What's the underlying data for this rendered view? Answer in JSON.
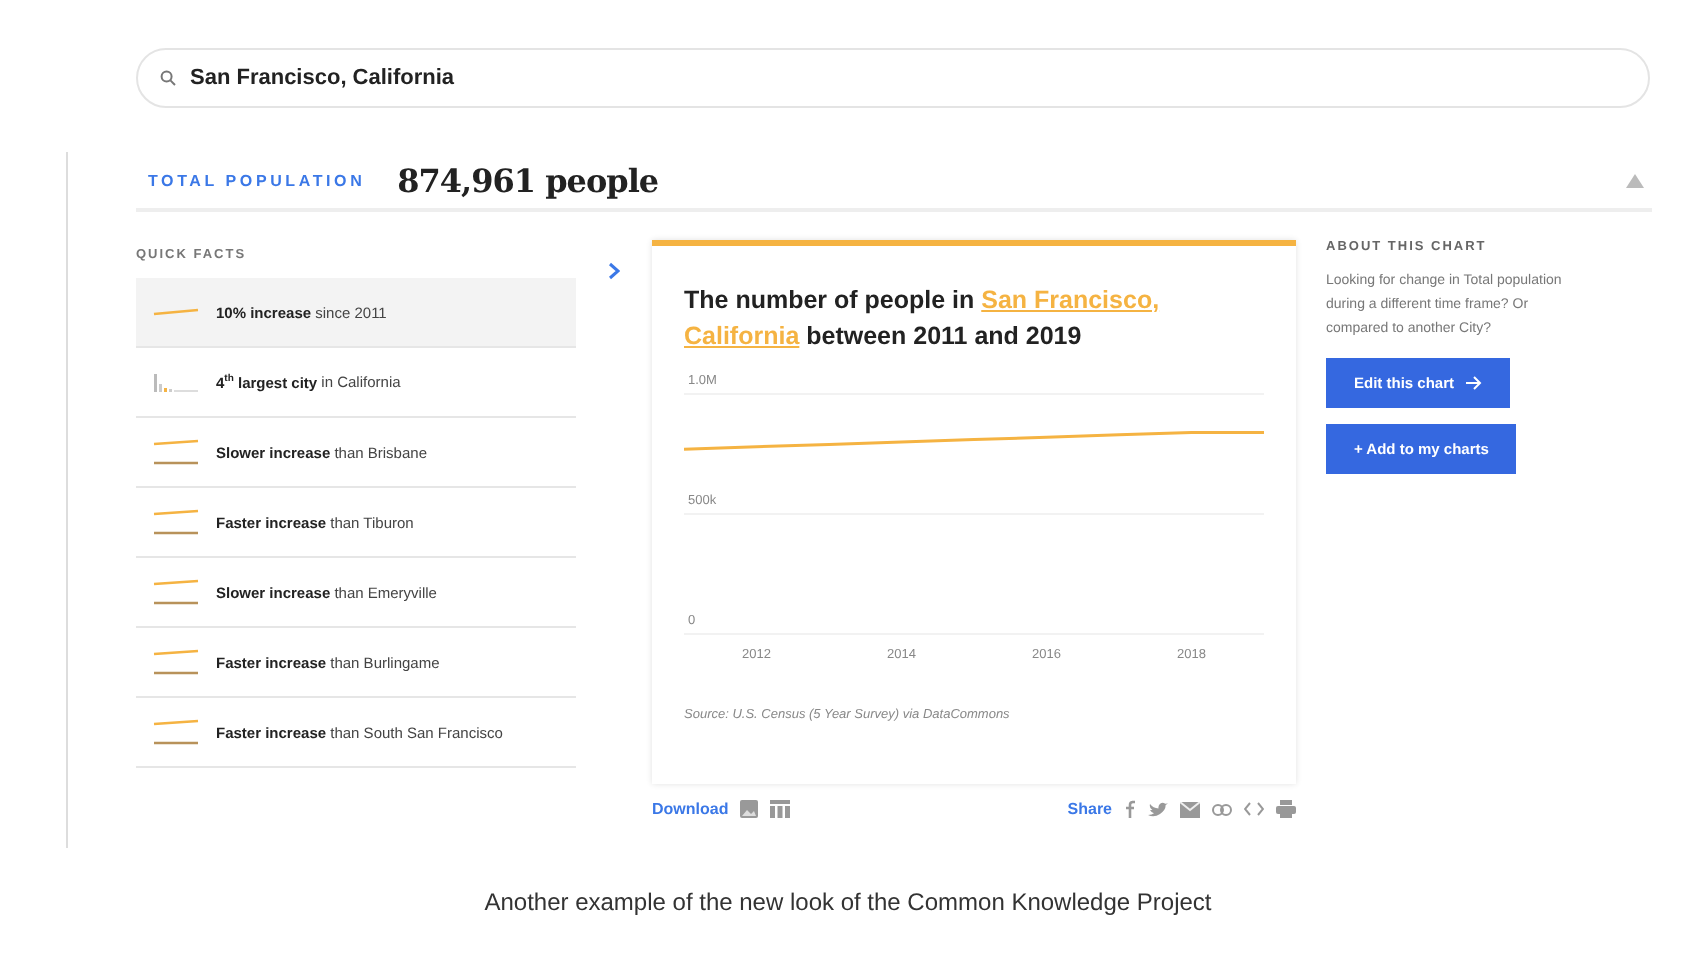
{
  "search": {
    "value": "San Francisco, California"
  },
  "header": {
    "label": "TOTAL POPULATION",
    "value": "874,961 people"
  },
  "quick_facts": {
    "title": "QUICK FACTS",
    "items": [
      {
        "kind": "line",
        "text": "**10% increase** since 2011",
        "selected": true
      },
      {
        "kind": "bars",
        "text": "**4$^{th}$ largest city** in California",
        "selected": false
      },
      {
        "kind": "compare",
        "text": "**Slower increase** than Brisbane",
        "selected": false
      },
      {
        "kind": "compare",
        "text": "**Faster increase** than Tiburon",
        "selected": false
      },
      {
        "kind": "compare",
        "text": "**Slower increase** than Emeryville",
        "selected": false
      },
      {
        "kind": "compare",
        "text": "**Faster increase** than Burlingame",
        "selected": false
      },
      {
        "kind": "compare",
        "text": "**Faster increase** than South San Francisco",
        "selected": false
      }
    ]
  },
  "chart": {
    "title_before": "The number of people in ",
    "title_link": [
      "San Francisco,",
      "California"
    ],
    "title_after": " between 2011 and 2019",
    "source": "Source: U.S. Census (5 Year Survey) via DataCommons",
    "chart_data": {
      "type": "line",
      "x": [
        2011,
        2012,
        2013,
        2014,
        2015,
        2016,
        2017,
        2018,
        2019
      ],
      "series": [
        {
          "color": "#f5b342",
          "values": [
            770000,
            780000,
            790000,
            800000,
            810000,
            820000,
            830000,
            840000,
            840000
          ]
        }
      ],
      "xticks": [
        2012,
        2014,
        2016,
        2018
      ],
      "yticks": [
        {
          "value": 0,
          "label": "0"
        },
        {
          "value": 500000,
          "label": "500k"
        },
        {
          "value": 1000000,
          "label": "1.0M"
        }
      ],
      "xlim": [
        2011,
        2019
      ],
      "ylim": [
        0,
        1000000
      ]
    }
  },
  "chart_actions": {
    "download": "Download",
    "share": "Share"
  },
  "about": {
    "title": "ABOUT THIS CHART",
    "text": "Looking for change in Total population during a different time frame? Or compared to another City?",
    "buttons": [
      {
        "label": "Edit this chart",
        "kind": "arrow"
      },
      {
        "label": "+ Add to my charts",
        "kind": "plain"
      }
    ]
  },
  "caption": "Another example of the new look of the Common Knowledge Project"
}
